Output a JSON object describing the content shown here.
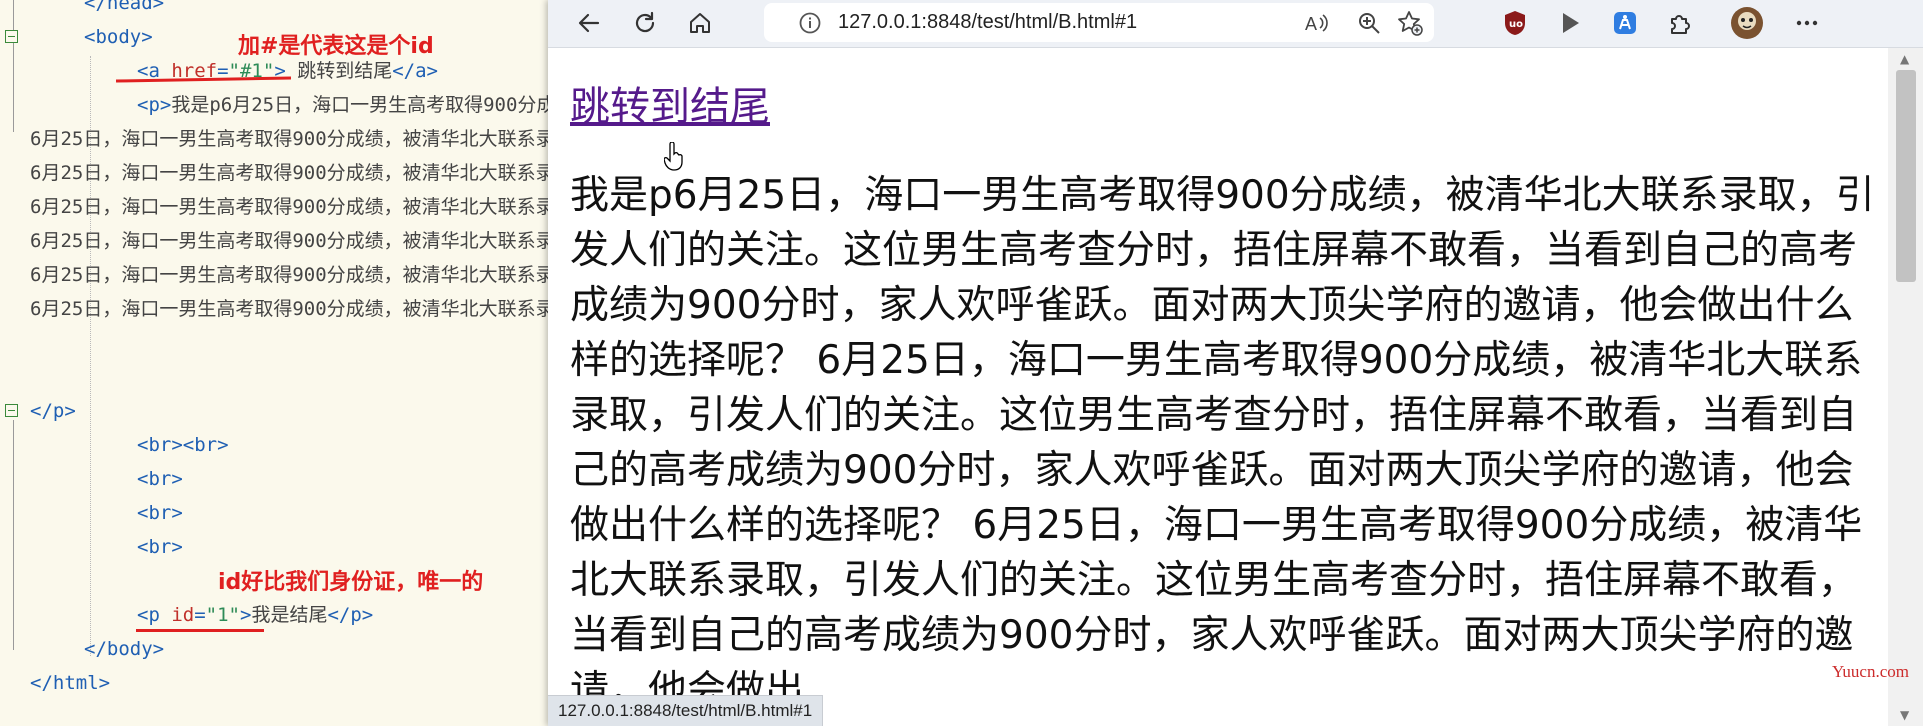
{
  "editor": {
    "head_close": "</head>",
    "body_open": "<body>",
    "a_tag_open": "<a ",
    "a_attr": "href",
    "a_eq": "=",
    "a_val": "\"#1\"",
    "a_gt": ">",
    "a_text": " 跳转到结尾",
    "a_close": "</a>",
    "p_open": "<p>",
    "p_text": "我是p6月25日，海口一男生高考取得900分成绩，被清华北大联系录取",
    "repeat_line": "6月25日，海口一男生高考取得900分成绩，被清华北大联系录取，引发人们的关注。",
    "p_close": "</p>",
    "br_double": "<br><br>",
    "br": "<br>",
    "p2_open": "<p ",
    "p2_attr": "id",
    "p2_eq": "=",
    "p2_val": "\"1\"",
    "p2_gt": ">",
    "p2_text": "我是结尾",
    "p2_close": "</p>",
    "body_close": "</body>",
    "html_close": "</html>",
    "annotation_1": "加#是代表这是个id",
    "annotation_2": "id好比我们身份证，唯一的"
  },
  "browser": {
    "url": "127.0.0.1:8848/test/html/B.html#1",
    "link_text": "跳转到结尾",
    "paragraph": "我是p6月25日，海口一男生高考取得900分成绩，被清华北大联系录取，引发人们的关注。这位男生高考查分时，捂住屏幕不敢看，当看到自己的高考成绩为900分时，家人欢呼雀跃。面对两大顶尖学府的邀请，他会做出什么样的选择呢？ 6月25日，海口一男生高考取得900分成绩，被清华北大联系录取，引发人们的关注。这位男生高考查分时，捂住屏幕不敢看，当看到自己的高考成绩为900分时，家人欢呼雀跃。面对两大顶尖学府的邀请，他会做出什么样的选择呢？ 6月25日，海口一男生高考取得900分成绩，被清华北大联系录取，引发人们的关注。这位男生高考查分时，捂住屏幕不敢看，当看到自己的高考成绩为900分时，家人欢呼雀跃。面对两大顶尖学府的邀请，他会做出",
    "status_url": "127.0.0.1:8848/test/html/B.html#1",
    "watermark": "Yuucn.com",
    "icons": [
      "back-icon",
      "refresh-icon",
      "home-icon",
      "info-icon",
      "read-aloud-icon",
      "zoom-icon",
      "favorite-icon",
      "ublock-icon",
      "play-icon",
      "extension-icon",
      "puzzle-icon",
      "avatar",
      "more-icon"
    ]
  }
}
